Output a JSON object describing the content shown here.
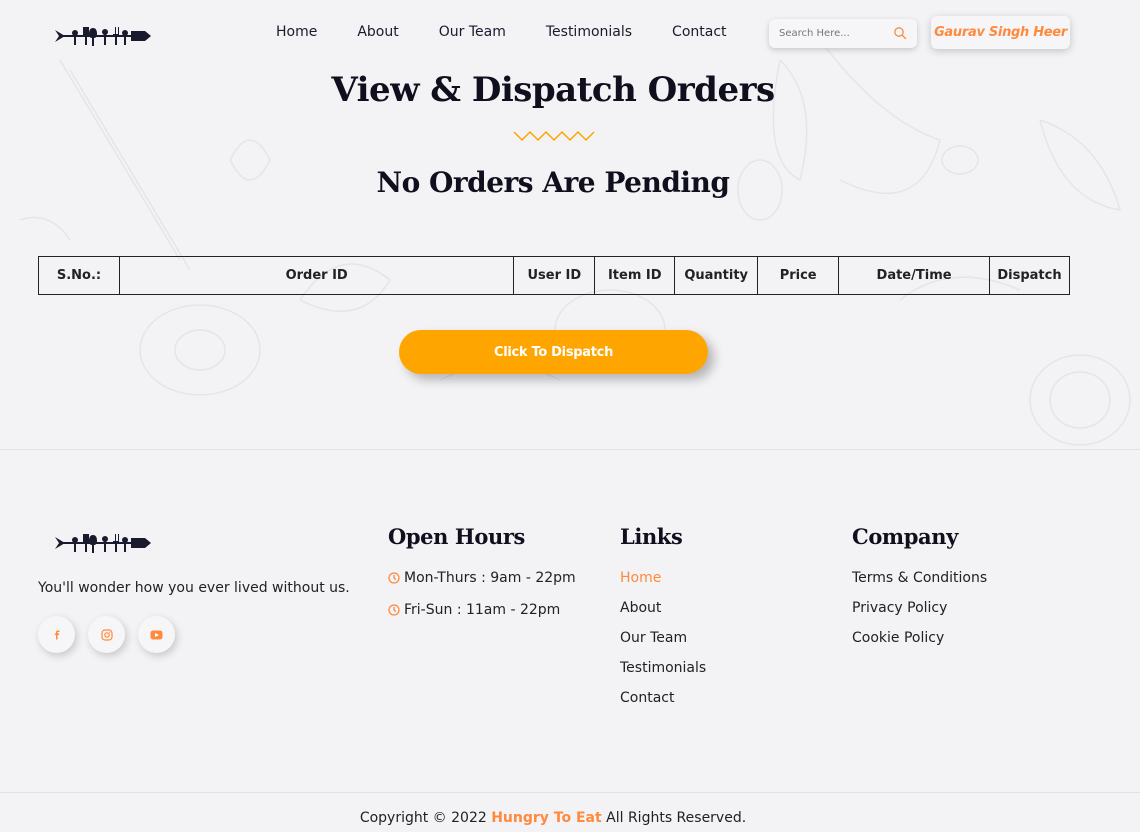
{
  "header": {
    "nav": [
      "Home",
      "About",
      "Our Team",
      "Testimonials",
      "Contact"
    ],
    "search_placeholder": "Search Here...",
    "user_name": "Gaurav Singh Heer"
  },
  "main": {
    "title": "View & Dispatch Orders",
    "subtitle": "No Orders Are Pending",
    "table_headers": [
      "S.No.:",
      "Order ID",
      "User ID",
      "Item ID",
      "Quantity",
      "Price",
      "Date/Time",
      "Dispatch"
    ],
    "dispatch_label": "Click To Dispatch"
  },
  "footer": {
    "tagline": "You'll wonder how you ever lived without us.",
    "socials": [
      "facebook-icon",
      "instagram-icon",
      "youtube-icon"
    ],
    "hours_title": "Open Hours",
    "hours": [
      "Mon-Thurs : 9am - 22pm",
      "Fri-Sun : 11am - 22pm"
    ],
    "links_title": "Links",
    "links": [
      "Home",
      "About",
      "Our Team",
      "Testimonials",
      "Contact"
    ],
    "company_title": "Company",
    "company": [
      "Terms & Conditions",
      "Privacy Policy",
      "Cookie Policy"
    ],
    "copyright_prefix": "Copyright © 2022",
    "copyright_brand": "Hungry To Eat",
    "copyright_suffix": "All Rights Reserved."
  },
  "colors": {
    "accent": "#ff8a3d",
    "button": "#ffa500",
    "background": "#f3f2f4",
    "text_dark": "#0f0f1e"
  }
}
